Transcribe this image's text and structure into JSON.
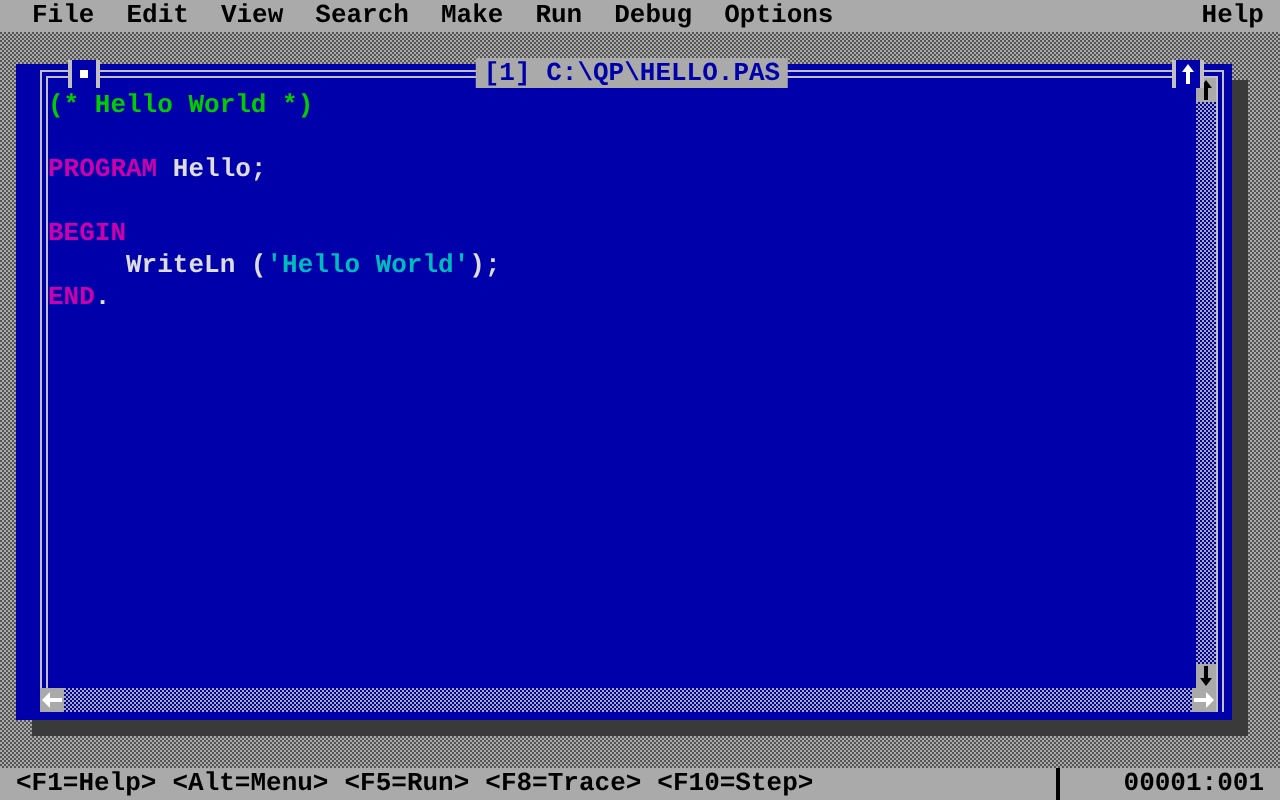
{
  "menu_bar": {
    "items": [
      {
        "label": "File"
      },
      {
        "label": "Edit"
      },
      {
        "label": "View"
      },
      {
        "label": "Search"
      },
      {
        "label": "Make"
      },
      {
        "label": "Run"
      },
      {
        "label": "Debug"
      },
      {
        "label": "Options"
      }
    ],
    "help": "Help"
  },
  "editor": {
    "title": "[1] C:\\QP\\HELLO.PAS",
    "lines": [
      {
        "kind": "code",
        "tokens": [
          {
            "kind": "comment",
            "text": "(* Hello World *)"
          }
        ]
      },
      {
        "kind": "blank"
      },
      {
        "kind": "code",
        "tokens": [
          {
            "kind": "keyword",
            "text": "PROGRAM"
          },
          {
            "kind": "ident",
            "text": " Hello;"
          }
        ]
      },
      {
        "kind": "blank"
      },
      {
        "kind": "code",
        "tokens": [
          {
            "kind": "keyword",
            "text": "BEGIN"
          }
        ]
      },
      {
        "kind": "code",
        "tokens": [
          {
            "kind": "ident",
            "text": "     WriteLn ("
          },
          {
            "kind": "string",
            "text": "'Hello World'"
          },
          {
            "kind": "ident",
            "text": ");"
          }
        ]
      },
      {
        "kind": "code",
        "tokens": [
          {
            "kind": "keyword",
            "text": "END"
          },
          {
            "kind": "ident",
            "text": "."
          }
        ]
      }
    ]
  },
  "status_bar": {
    "hints": [
      {
        "label": "<F1=Help>"
      },
      {
        "label": "<Alt=Menu>"
      },
      {
        "label": "<F5=Run>"
      },
      {
        "label": "<F8=Trace>"
      },
      {
        "label": "<F10=Step>"
      }
    ],
    "position": "00001:001"
  }
}
